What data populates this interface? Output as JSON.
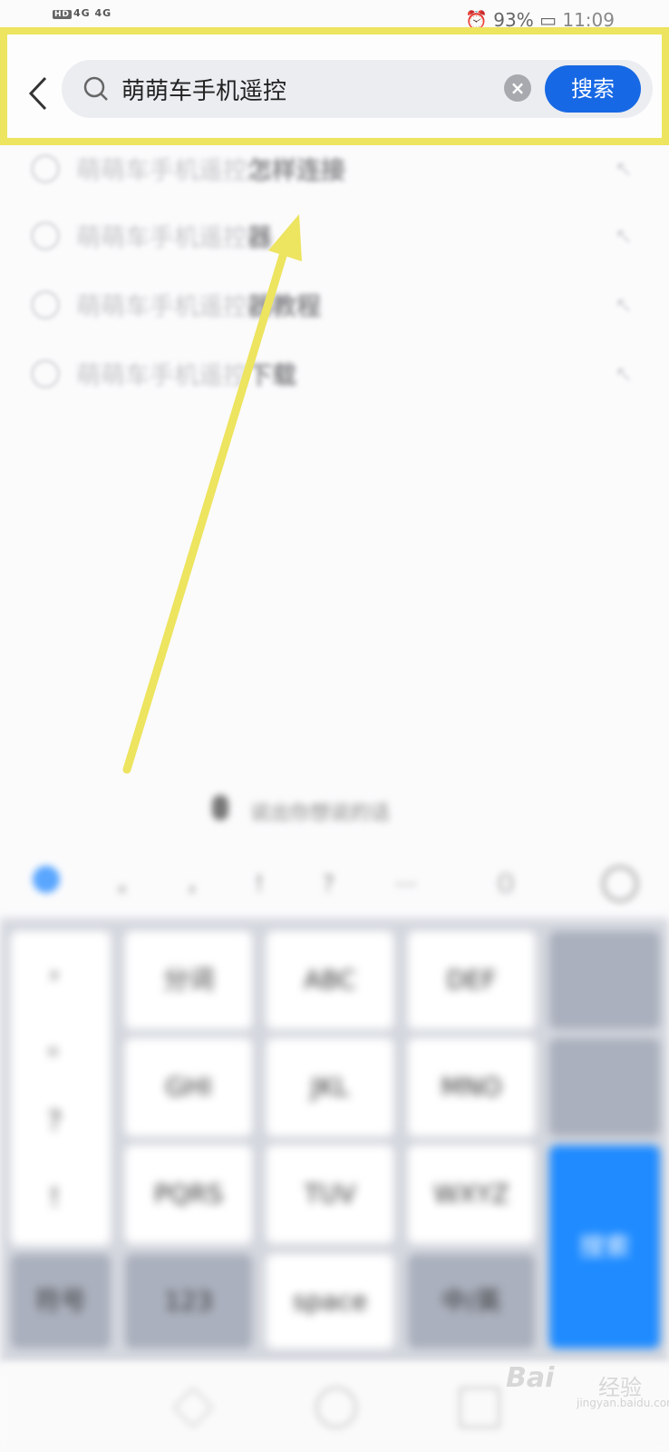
{
  "status_bar": {
    "left_indicators": "4G 4G",
    "battery_text": "93%",
    "time": "11:09"
  },
  "search": {
    "query": "萌萌车手机遥控",
    "button_label": "搜索"
  },
  "suggestions": [
    {
      "prefix": "萌萌车手机遥控",
      "suffix": "怎样连接"
    },
    {
      "prefix": "萌萌车手机遥控",
      "suffix": "器"
    },
    {
      "prefix": "萌萌车手机遥控",
      "suffix": "器教程"
    },
    {
      "prefix": "萌萌车手机遥控",
      "suffix": "下载"
    }
  ],
  "voice_hint": "说出你想说的话",
  "candidates": [
    "。",
    "，",
    "！",
    "？",
    "…",
    "（）",
    "：）"
  ],
  "keyboard": {
    "row1": [
      "分词",
      "ABC",
      "DEF"
    ],
    "row2": [
      "GHI",
      "JKL",
      "MNO"
    ],
    "row3": [
      "PQRS",
      "TUV",
      "WXYZ"
    ],
    "left_symbols": [
      "，",
      "。",
      "？",
      "！"
    ],
    "bottom": [
      "符号",
      "123",
      "space",
      "中/英"
    ],
    "enter_label": "搜索"
  },
  "watermark": {
    "brand": "Bai",
    "cn": "经验",
    "url": "jingyan.baidu.com"
  },
  "colors": {
    "annotation": "#ede45f",
    "accent": "#1768e4"
  }
}
